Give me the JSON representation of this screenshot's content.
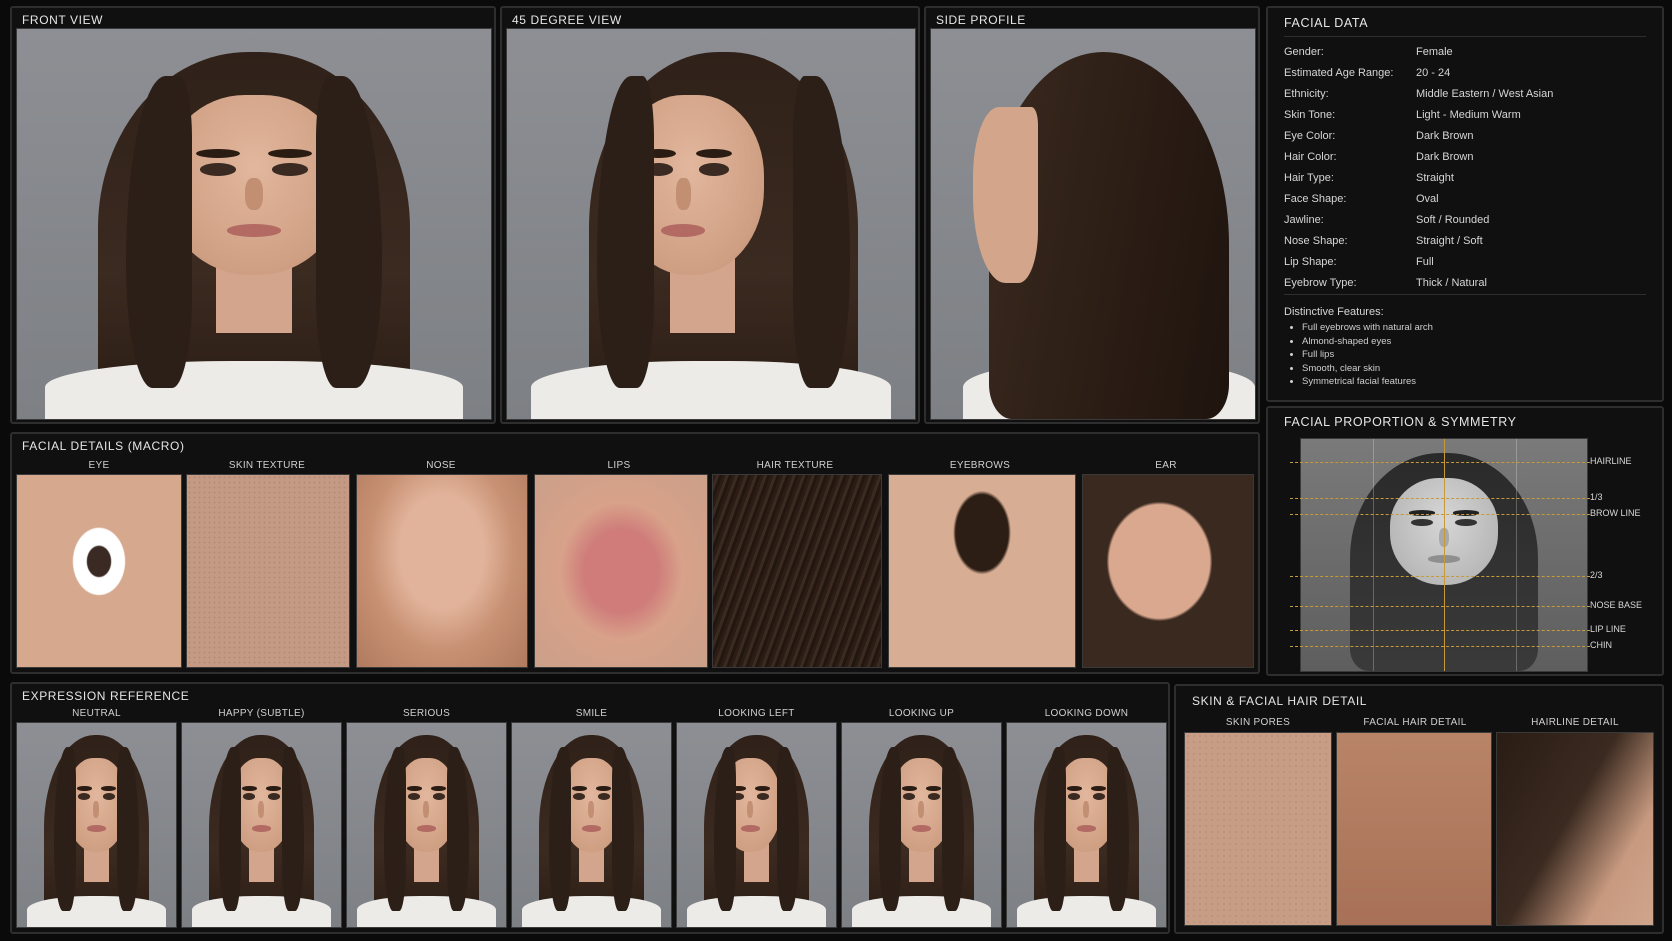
{
  "views": {
    "front": "FRONT VIEW",
    "degree45": "45 DEGREE VIEW",
    "side": "SIDE PROFILE"
  },
  "facial_data": {
    "title": "FACIAL DATA",
    "rows": [
      {
        "k": "Gender:",
        "v": "Female"
      },
      {
        "k": "Estimated Age Range:",
        "v": "20 - 24"
      },
      {
        "k": "Ethnicity:",
        "v": "Middle Eastern / West Asian"
      },
      {
        "k": "Skin Tone:",
        "v": "Light - Medium Warm"
      },
      {
        "k": "Eye Color:",
        "v": "Dark Brown"
      },
      {
        "k": "Hair Color:",
        "v": "Dark Brown"
      },
      {
        "k": "Hair Type:",
        "v": "Straight"
      },
      {
        "k": "Face Shape:",
        "v": "Oval"
      },
      {
        "k": "Jawline:",
        "v": "Soft / Rounded"
      },
      {
        "k": "Nose Shape:",
        "v": "Straight / Soft"
      },
      {
        "k": "Lip Shape:",
        "v": "Full"
      },
      {
        "k": "Eyebrow Type:",
        "v": "Thick / Natural"
      }
    ],
    "distinctive_title": "Distinctive Features:",
    "features": [
      "Full eyebrows with natural arch",
      "Almond-shaped eyes",
      "Full lips",
      "Smooth, clear skin",
      "Symmetrical facial features"
    ]
  },
  "proportion": {
    "title": "FACIAL PROPORTION & SYMMETRY",
    "labels": [
      "HAIRLINE",
      "1/3",
      "BROW LINE",
      "2/3",
      "NOSE BASE",
      "LIP LINE",
      "CHIN"
    ]
  },
  "macro": {
    "title": "FACIAL DETAILS (MACRO)",
    "labels": [
      "EYE",
      "SKIN TEXTURE",
      "NOSE",
      "LIPS",
      "HAIR TEXTURE",
      "EYEBROWS",
      "EAR"
    ]
  },
  "expression": {
    "title": "EXPRESSION REFERENCE",
    "labels": [
      "NEUTRAL",
      "HAPPY (SUBTLE)",
      "SERIOUS",
      "SMILE",
      "LOOKING LEFT",
      "LOOKING UP",
      "LOOKING DOWN"
    ]
  },
  "skin_detail": {
    "title": "SKIN & FACIAL HAIR DETAIL",
    "labels": [
      "SKIN PORES",
      "FACIAL HAIR DETAIL",
      "HAIRLINE DETAIL"
    ]
  },
  "colors": {
    "background": "#0a0a0a",
    "panel_border": "#2e2e2e",
    "guide_line": "#c69a3a"
  }
}
